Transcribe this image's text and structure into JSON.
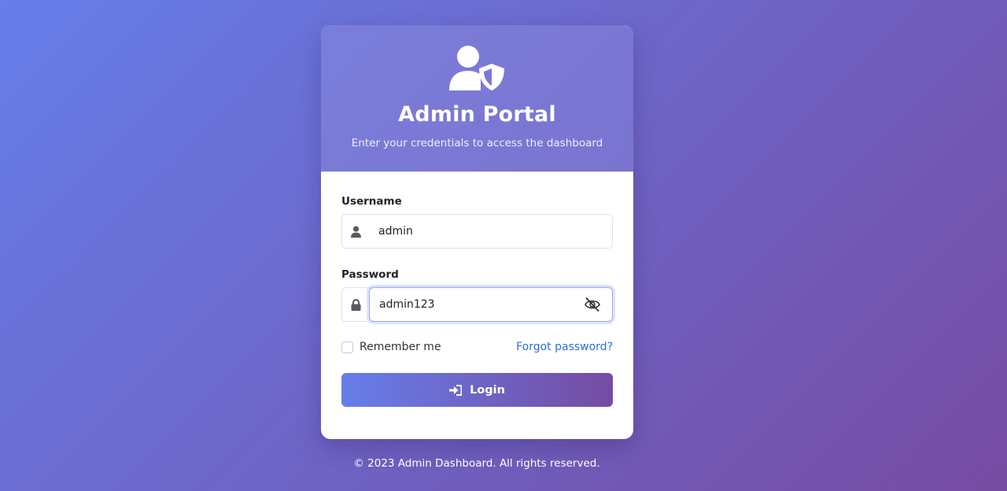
{
  "header": {
    "icon": "user-shield-icon",
    "title": "Admin Portal",
    "subtitle": "Enter your credentials to access the dashboard"
  },
  "form": {
    "username_label": "Username",
    "username_icon": "user-icon",
    "username_value": "admin",
    "password_label": "Password",
    "password_icon": "lock-icon",
    "password_value": "admin123",
    "password_toggle_icon": "eye-slash-icon",
    "remember_label": "Remember me",
    "remember_checked": false,
    "forgot_label": "Forgot password?",
    "login_icon": "sign-in-icon",
    "login_label": "Login"
  },
  "footer": {
    "text": "© 2023 Admin Dashboard. All rights reserved."
  },
  "colors": {
    "gradient_start": "#667eea",
    "gradient_end": "#764ba2",
    "link": "#2a6fdb"
  }
}
